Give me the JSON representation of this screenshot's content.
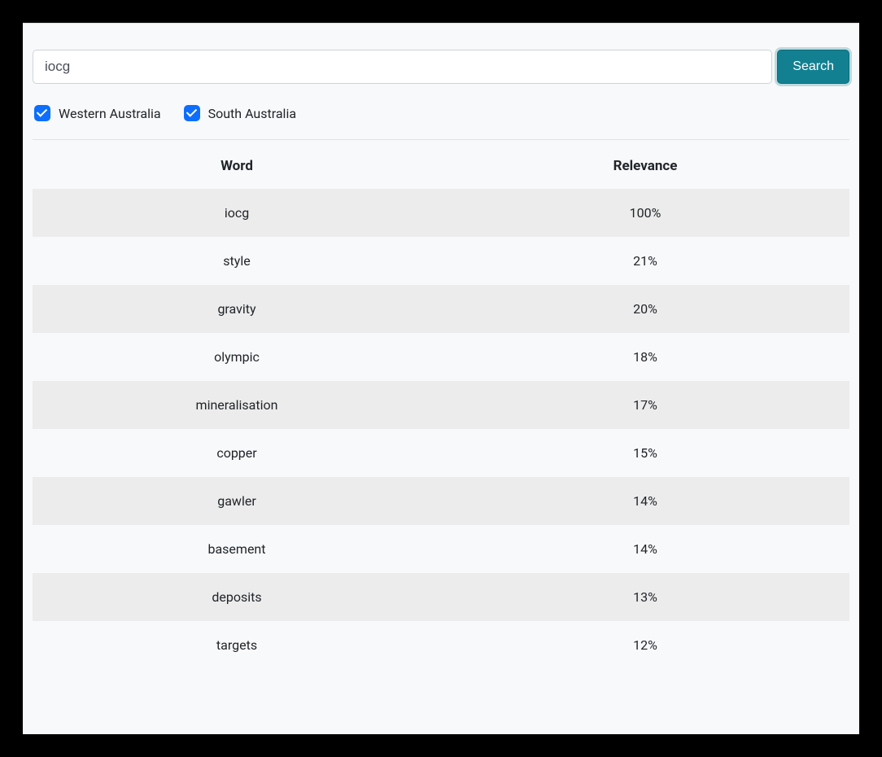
{
  "search": {
    "value": "iocg",
    "button_label": "Search"
  },
  "filters": [
    {
      "label": "Western Australia",
      "checked": true
    },
    {
      "label": "South Australia",
      "checked": true
    }
  ],
  "table": {
    "headers": {
      "word": "Word",
      "relevance": "Relevance"
    },
    "rows": [
      {
        "word": "iocg",
        "relevance": "100%"
      },
      {
        "word": "style",
        "relevance": "21%"
      },
      {
        "word": "gravity",
        "relevance": "20%"
      },
      {
        "word": "olympic",
        "relevance": "18%"
      },
      {
        "word": "mineralisation",
        "relevance": "17%"
      },
      {
        "word": "copper",
        "relevance": "15%"
      },
      {
        "word": "gawler",
        "relevance": "14%"
      },
      {
        "word": "basement",
        "relevance": "14%"
      },
      {
        "word": "deposits",
        "relevance": "13%"
      },
      {
        "word": "targets",
        "relevance": "12%"
      }
    ]
  }
}
